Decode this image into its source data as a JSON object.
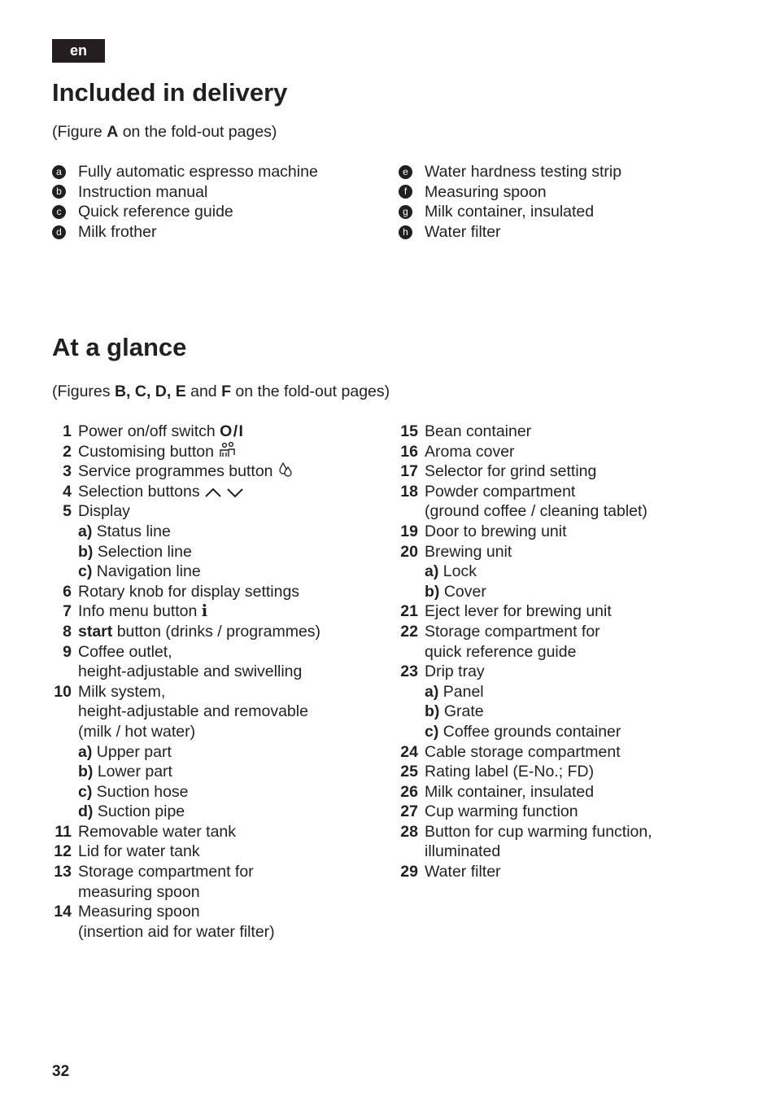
{
  "language_badge": "en",
  "included": {
    "title": "Included in delivery",
    "subtitle": {
      "prefix": "(Figure ",
      "figure": "A",
      "suffix": " on the fold-out pages)"
    },
    "left_items": [
      {
        "marker": "a",
        "label": "Fully automatic espresso machine"
      },
      {
        "marker": "b",
        "label": "Instruction manual"
      },
      {
        "marker": "c",
        "label": "Quick reference guide"
      },
      {
        "marker": "d",
        "label": "Milk frother"
      }
    ],
    "right_items": [
      {
        "marker": "e",
        "label": "Water hardness testing strip"
      },
      {
        "marker": "f",
        "label": "Measuring spoon"
      },
      {
        "marker": "g",
        "label": "Milk container, insulated"
      },
      {
        "marker": "h",
        "label": "Water filter"
      }
    ]
  },
  "glance": {
    "title": "At a glance",
    "subtitle": {
      "prefix": "(Figures ",
      "figures": "B, C, D, E",
      "and": " and ",
      "last_figure": "F",
      "suffix": " on the fold-out pages)"
    },
    "items": {
      "1": {
        "num": "1",
        "text": "Power on/off switch ",
        "symbol": "O / I",
        "icon": "power-symbol"
      },
      "2": {
        "num": "2",
        "text": "Customising button ",
        "icon": "customising-icon"
      },
      "3": {
        "num": "3",
        "text": "Service programmes button ",
        "icon": "service-drops-icon"
      },
      "4": {
        "num": "4",
        "text": "Selection buttons ",
        "icon": "chevron-up-down-icon"
      },
      "5": {
        "num": "5",
        "text": "Display",
        "subs": [
          {
            "key": "a)",
            "text": " Status line"
          },
          {
            "key": "b)",
            "text": " Selection line"
          },
          {
            "key": "c)",
            "text": " Navigation line"
          }
        ]
      },
      "6": {
        "num": "6",
        "text": "Rotary knob for display settings"
      },
      "7": {
        "num": "7",
        "text": "Info menu button ",
        "symbol": "i",
        "icon": "info-icon"
      },
      "8": {
        "num": "8",
        "bold_prefix": "start",
        "text": " button (drinks / programmes)"
      },
      "9": {
        "num": "9",
        "lines": [
          "Coffee outlet,",
          "height-adjustable and swivelling"
        ]
      },
      "10": {
        "num": "10",
        "lines": [
          "Milk system,",
          "height-adjustable and removable",
          "(milk / hot water)"
        ],
        "subs": [
          {
            "key": "a)",
            "text": " Upper part"
          },
          {
            "key": "b)",
            "text": " Lower part"
          },
          {
            "key": "c)",
            "text": " Suction hose"
          },
          {
            "key": "d)",
            "text": " Suction pipe"
          }
        ]
      },
      "11": {
        "num": "11",
        "text": "Removable water tank"
      },
      "12": {
        "num": "12",
        "text": "Lid for water tank"
      },
      "13": {
        "num": "13",
        "lines": [
          "Storage compartment for",
          "measuring spoon"
        ]
      },
      "14": {
        "num": "14",
        "lines": [
          "Measuring spoon",
          "(insertion aid for water filter)"
        ]
      },
      "15": {
        "num": "15",
        "text": "Bean container"
      },
      "16": {
        "num": "16",
        "text": "Aroma cover"
      },
      "17": {
        "num": "17",
        "text": "Selector for grind setting"
      },
      "18": {
        "num": "18",
        "lines": [
          "Powder compartment",
          "(ground coffee / cleaning tablet)"
        ]
      },
      "19": {
        "num": "19",
        "text": "Door to brewing unit"
      },
      "20": {
        "num": "20",
        "text": "Brewing unit",
        "subs": [
          {
            "key": "a)",
            "text": " Lock"
          },
          {
            "key": "b)",
            "text": " Cover"
          }
        ]
      },
      "21": {
        "num": "21",
        "text": "Eject lever for brewing unit"
      },
      "22": {
        "num": "22",
        "lines": [
          "Storage compartment for",
          "quick reference guide"
        ]
      },
      "23": {
        "num": "23",
        "text": "Drip tray",
        "subs": [
          {
            "key": "a)",
            "text": " Panel"
          },
          {
            "key": "b)",
            "text": " Grate"
          },
          {
            "key": "c)",
            "text": " Coffee grounds container"
          }
        ]
      },
      "24": {
        "num": "24",
        "text": "Cable storage compartment"
      },
      "25": {
        "num": "25",
        "text": "Rating label (E-No.; FD)"
      },
      "26": {
        "num": "26",
        "text": "Milk container, insulated"
      },
      "27": {
        "num": "27",
        "text": "Cup warming function"
      },
      "28": {
        "num": "28",
        "lines": [
          "Button for cup warming function,",
          "illuminated"
        ]
      },
      "29": {
        "num": "29",
        "text": "Water filter"
      }
    }
  },
  "page_number": "32"
}
